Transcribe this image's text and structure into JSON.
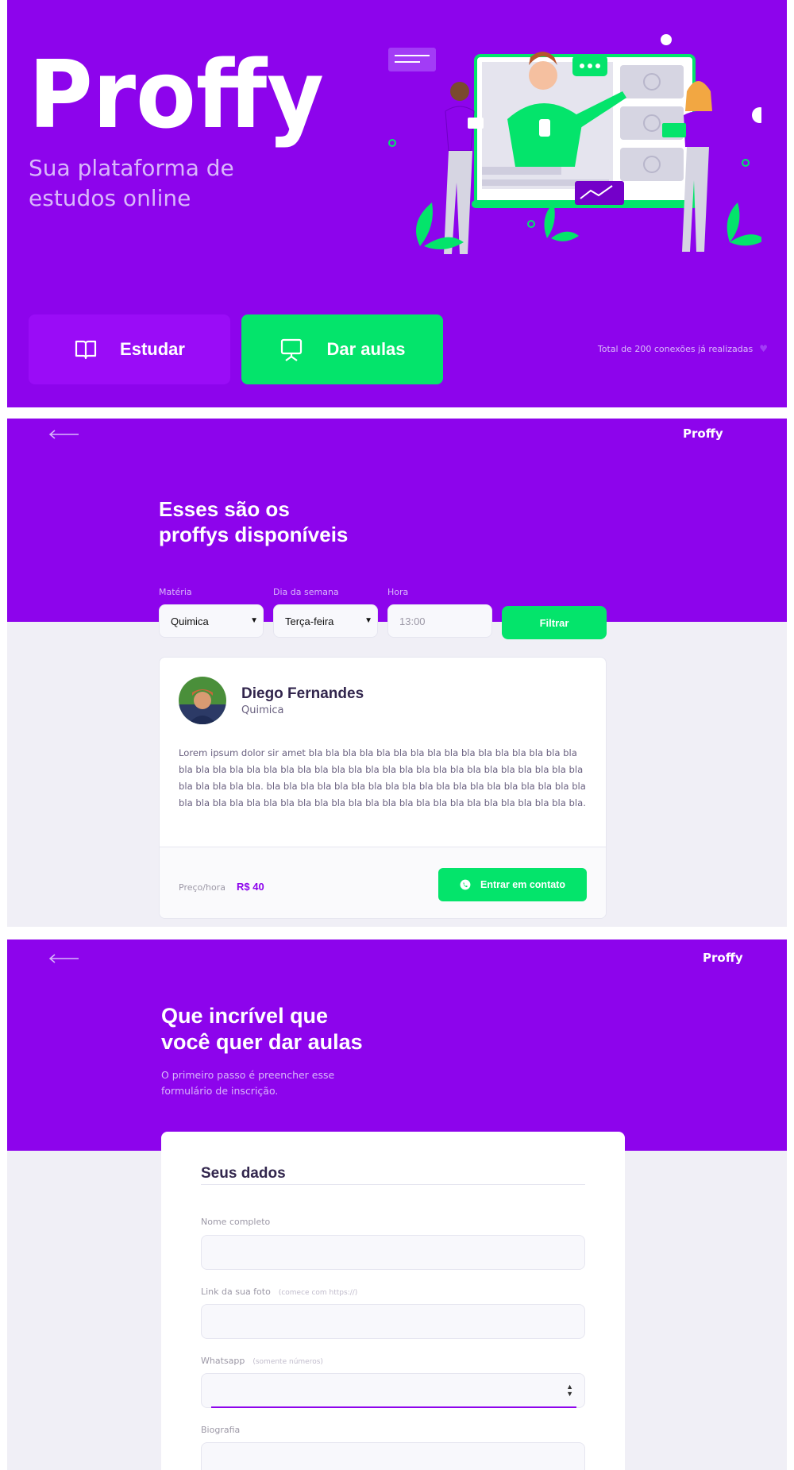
{
  "landing": {
    "logo": "Proffy",
    "tagline": "Sua plataforma de estudos online",
    "study_button": "Estudar",
    "teach_button": "Dar aulas",
    "connections": "Total de 200 conexões já realizadas",
    "colors": {
      "primary": "#8d04ec",
      "secondary": "#04e46b"
    },
    "icons": [
      "book-open-icon",
      "presentation-board-icon",
      "purple-heart-icon"
    ]
  },
  "study": {
    "logo": "Proffy",
    "title_line1": "Esses são os",
    "title_line2": "proffys disponíveis",
    "filters": {
      "subject_label": "Matéria",
      "subject_value": "Quimica",
      "weekday_label": "Dia da semana",
      "weekday_value": "Terça-feira",
      "time_label": "Hora",
      "time_placeholder": "13:00",
      "submit": "Filtrar"
    },
    "teacher": {
      "name": "Diego Fernandes",
      "subject": "Quimica",
      "bio": "Lorem ipsum dolor sir amet bla bla bla bla bla bla bla bla bla bla bla bla bla bla bla bla bla bla bla bla bla bla bla bla bla bla bla bla bla bla bla bla bla bla bla bla bla bla bla bla bla bla bla bla bla. bla bla bla bla bla bla bla bla bla bla bla bla bla bla bla bla bla bla bla bla bla bla bla bla bla bla bla bla bla bla bla bla bla bla bla bla bla bla bla bla bla bla bla.",
      "price_label": "Preço/hora",
      "price_value": "R$ 40",
      "contact_button": "Entrar em contato"
    }
  },
  "teach": {
    "logo": "Proffy",
    "title_line1": "Que incrível que",
    "title_line2": "você quer dar aulas",
    "subtitle": "O primeiro passo é preencher esse formulário de inscrição.",
    "form": {
      "section_title": "Seus dados",
      "name_label": "Nome completo",
      "photo_label": "Link da sua foto",
      "photo_hint": "(comece com https://)",
      "whatsapp_label": "Whatsapp",
      "whatsapp_hint": "(somente números)",
      "bio_label": "Biografia"
    }
  }
}
